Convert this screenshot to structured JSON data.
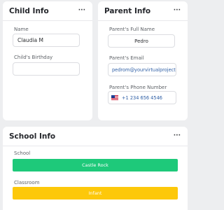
{
  "child_info": {
    "title": "Child Info",
    "menu_glyph": "···",
    "name_label": "Name",
    "name_value": "Claudia M",
    "birthday_label": "Child's Birthday",
    "birthday_value": ""
  },
  "parent_info": {
    "title": "Parent Info",
    "menu_glyph": "···",
    "full_name_label": "Parent's Full Name",
    "full_name_value": "Pedro",
    "email_label": "Parent's Email",
    "email_value": "pedrom@yourvirtualproject...",
    "phone_label": "Parent's Phone Number",
    "phone_value": "+1 234 656 4546",
    "phone_flag_icon": "us-flag-icon"
  },
  "school_info": {
    "title": "School Info",
    "menu_glyph": "···",
    "school_label": "School",
    "school_value": "Castle Rock",
    "school_color": "#1ec97a",
    "classroom_label": "Classroom",
    "classroom_value": "Infant",
    "classroom_color": "#fdc80a"
  }
}
